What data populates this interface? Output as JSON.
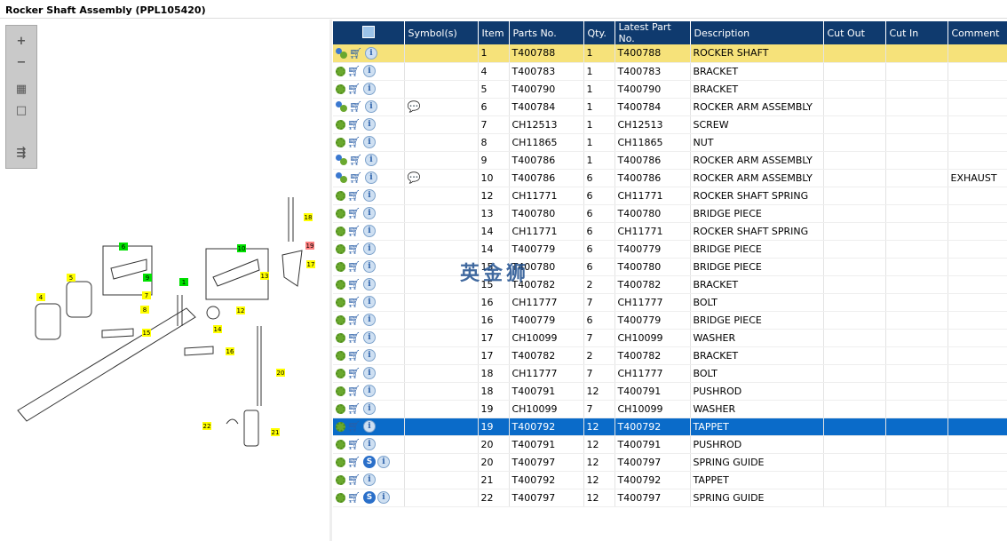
{
  "title": "Rocker Shaft Assembly (PPL105420)",
  "toolbar": {
    "zoom_in": "+",
    "zoom_out": "−",
    "fit": "▦",
    "single": "□",
    "export": "⇶"
  },
  "columns": [
    "",
    "Symbol(s)",
    "Item",
    "Parts No.",
    "Qty.",
    "Latest Part No.",
    "Description",
    "Cut Out",
    "Cut In",
    "Comment"
  ],
  "rows": [
    {
      "multi": true,
      "sym": "",
      "item": "1",
      "part": "T400788",
      "qty": "1",
      "latest": "T400788",
      "desc": "ROCKER SHAFT",
      "comment": "",
      "state": "hl"
    },
    {
      "multi": false,
      "sym": "",
      "item": "4",
      "part": "T400783",
      "qty": "1",
      "latest": "T400783",
      "desc": "BRACKET",
      "comment": ""
    },
    {
      "multi": false,
      "sym": "",
      "item": "5",
      "part": "T400790",
      "qty": "1",
      "latest": "T400790",
      "desc": "BRACKET",
      "comment": ""
    },
    {
      "multi": true,
      "sym": "💬",
      "item": "6",
      "part": "T400784",
      "qty": "1",
      "latest": "T400784",
      "desc": "ROCKER ARM ASSEMBLY",
      "comment": ""
    },
    {
      "multi": false,
      "sym": "",
      "item": "7",
      "part": "CH12513",
      "qty": "1",
      "latest": "CH12513",
      "desc": "SCREW",
      "comment": ""
    },
    {
      "multi": false,
      "sym": "",
      "item": "8",
      "part": "CH11865",
      "qty": "1",
      "latest": "CH11865",
      "desc": "NUT",
      "comment": ""
    },
    {
      "multi": true,
      "sym": "",
      "item": "9",
      "part": "T400786",
      "qty": "1",
      "latest": "T400786",
      "desc": "ROCKER ARM ASSEMBLY",
      "comment": ""
    },
    {
      "multi": true,
      "sym": "💬",
      "item": "10",
      "part": "T400786",
      "qty": "6",
      "latest": "T400786",
      "desc": "ROCKER ARM ASSEMBLY",
      "comment": "EXHAUST"
    },
    {
      "multi": false,
      "sym": "",
      "item": "12",
      "part": "CH11771",
      "qty": "6",
      "latest": "CH11771",
      "desc": "ROCKER SHAFT SPRING",
      "comment": ""
    },
    {
      "multi": false,
      "sym": "",
      "item": "13",
      "part": "T400780",
      "qty": "6",
      "latest": "T400780",
      "desc": "BRIDGE PIECE",
      "comment": ""
    },
    {
      "multi": false,
      "sym": "",
      "item": "14",
      "part": "CH11771",
      "qty": "6",
      "latest": "CH11771",
      "desc": "ROCKER SHAFT SPRING",
      "comment": ""
    },
    {
      "multi": false,
      "sym": "",
      "item": "14",
      "part": "T400779",
      "qty": "6",
      "latest": "T400779",
      "desc": "BRIDGE PIECE",
      "comment": ""
    },
    {
      "multi": false,
      "sym": "",
      "item": "15",
      "part": "T400780",
      "qty": "6",
      "latest": "T400780",
      "desc": "BRIDGE PIECE",
      "comment": ""
    },
    {
      "multi": false,
      "sym": "",
      "item": "15",
      "part": "T400782",
      "qty": "2",
      "latest": "T400782",
      "desc": "BRACKET",
      "comment": ""
    },
    {
      "multi": false,
      "sym": "",
      "item": "16",
      "part": "CH11777",
      "qty": "7",
      "latest": "CH11777",
      "desc": "BOLT",
      "comment": ""
    },
    {
      "multi": false,
      "sym": "",
      "item": "16",
      "part": "T400779",
      "qty": "6",
      "latest": "T400779",
      "desc": "BRIDGE PIECE",
      "comment": ""
    },
    {
      "multi": false,
      "sym": "",
      "item": "17",
      "part": "CH10099",
      "qty": "7",
      "latest": "CH10099",
      "desc": "WASHER",
      "comment": ""
    },
    {
      "multi": false,
      "sym": "",
      "item": "17",
      "part": "T400782",
      "qty": "2",
      "latest": "T400782",
      "desc": "BRACKET",
      "comment": ""
    },
    {
      "multi": false,
      "sym": "",
      "item": "18",
      "part": "CH11777",
      "qty": "7",
      "latest": "CH11777",
      "desc": "BOLT",
      "comment": ""
    },
    {
      "multi": false,
      "sym": "",
      "item": "18",
      "part": "T400791",
      "qty": "12",
      "latest": "T400791",
      "desc": "PUSHROD",
      "comment": ""
    },
    {
      "multi": false,
      "sym": "",
      "item": "19",
      "part": "CH10099",
      "qty": "7",
      "latest": "CH10099",
      "desc": "WASHER",
      "comment": ""
    },
    {
      "multi": false,
      "sym": "",
      "item": "19",
      "part": "T400792",
      "qty": "12",
      "latest": "T400792",
      "desc": "TAPPET",
      "comment": "",
      "state": "sel"
    },
    {
      "multi": false,
      "sym": "",
      "item": "20",
      "part": "T400791",
      "qty": "12",
      "latest": "T400791",
      "desc": "PUSHROD",
      "comment": ""
    },
    {
      "multi": false,
      "s": true,
      "sym": "",
      "item": "20",
      "part": "T400797",
      "qty": "12",
      "latest": "T400797",
      "desc": "SPRING GUIDE",
      "comment": ""
    },
    {
      "multi": false,
      "sym": "",
      "item": "21",
      "part": "T400792",
      "qty": "12",
      "latest": "T400792",
      "desc": "TAPPET",
      "comment": ""
    },
    {
      "multi": false,
      "s": true,
      "sym": "",
      "item": "22",
      "part": "T400797",
      "qty": "12",
      "latest": "T400797",
      "desc": "SPRING GUIDE",
      "comment": ""
    }
  ],
  "callouts": [
    {
      "n": "4",
      "c": "#ffff00"
    },
    {
      "n": "5",
      "c": "#ffff00"
    },
    {
      "n": "6",
      "c": "#00e000"
    },
    {
      "n": "9",
      "c": "#00e000"
    },
    {
      "n": "7",
      "c": "#ffff00"
    },
    {
      "n": "8",
      "c": "#ffff00"
    },
    {
      "n": "1",
      "c": "#00e000"
    },
    {
      "n": "10",
      "c": "#00e000"
    },
    {
      "n": "13",
      "c": "#ffff00"
    },
    {
      "n": "18",
      "c": "#ffff00"
    },
    {
      "n": "19",
      "c": "#ff8080"
    },
    {
      "n": "17",
      "c": "#ffff00"
    },
    {
      "n": "14",
      "c": "#ffff00"
    },
    {
      "n": "12",
      "c": "#ffff00"
    },
    {
      "n": "15",
      "c": "#ffff00"
    },
    {
      "n": "16",
      "c": "#ffff00"
    },
    {
      "n": "20",
      "c": "#ffff00"
    },
    {
      "n": "22",
      "c": "#ffff00"
    },
    {
      "n": "21",
      "c": "#ffff00"
    }
  ],
  "watermark": "英金狮"
}
